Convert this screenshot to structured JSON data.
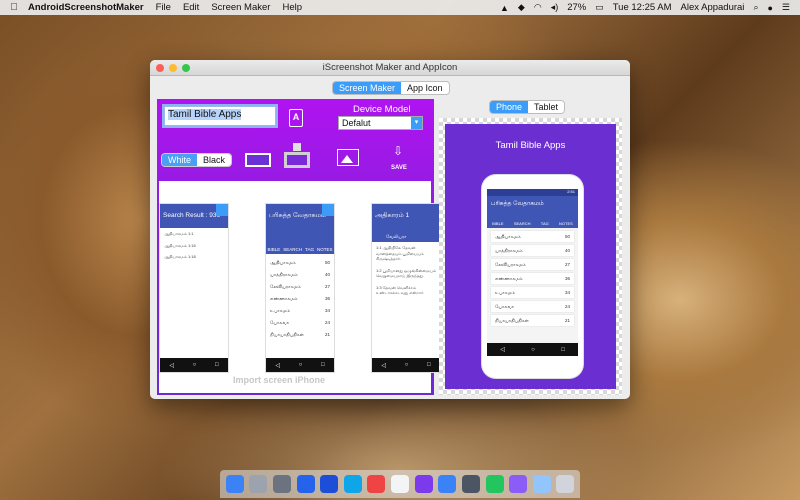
{
  "menubar": {
    "app_name": "AndroidScreenshotMaker",
    "menus": [
      "File",
      "Edit",
      "Screen Maker",
      "Help"
    ],
    "battery": "27%",
    "datetime": "Tue 12:25 AM",
    "user": "Alex Appadurai"
  },
  "window": {
    "title": "iScreenshot Maker and AppIcon",
    "tabs": [
      "Screen Maker",
      "App Icon"
    ],
    "active_tab": "Screen Maker"
  },
  "editor": {
    "title_value": "Tamil Bible Apps",
    "device_model_label": "Device Model",
    "device_model_value": "Defalut",
    "color_options": [
      "White",
      "Black"
    ],
    "active_color": "White",
    "save_label": "SAVE",
    "import_label": "Import screen iPhone"
  },
  "device_tabs": [
    "Phone",
    "Tablet"
  ],
  "active_device": "Phone",
  "screens": [
    {
      "header": "Search Result : 936",
      "texts": [
        "ஆதியாகமம் 1:1",
        "ஆதியாகமம் 1:16",
        "ஆதியாகமம் 1:18"
      ]
    },
    {
      "header": "பரிசுத்த வேதாகமம்",
      "tabs": [
        "BIBLE",
        "SEARCH",
        "TAG",
        "NOTES"
      ],
      "rows": [
        [
          "ஆதியாகமம்",
          "50"
        ],
        [
          "யாத்திராகமம்",
          "40"
        ],
        [
          "லேவியராகமம்",
          "27"
        ],
        [
          "எண்ணாகமம்",
          "36"
        ],
        [
          "உபாகமம்",
          "34"
        ],
        [
          "யோசுவா",
          "24"
        ],
        [
          "நியாயாதிபதிகள்",
          "21"
        ]
      ]
    },
    {
      "header": "அதிகாரம் 1",
      "sub": "வேலியரா",
      "texts": [
        "1:1 ஆதியிலே தேவன் வானத்தையும் பூமியையும் சிருஷ்டித்தார்.",
        "1:2 பூமியானது ஒழுங்கின்மையும் வெறுமையுமாய் இருந்தது.",
        "1:3 தேவன் வெளிச்சம் உண்டாகக்கடவது என்றார்."
      ]
    }
  ],
  "preview": {
    "title": "Tamil Bible Apps",
    "status_time": "2:51",
    "app_title": "பரிசுத்த வேதாகமம்",
    "tabs": [
      "BIBLE",
      "SEARCH",
      "TAG",
      "NOTES"
    ],
    "rows": [
      [
        "ஆதியாகமம்",
        "50"
      ],
      [
        "யாத்திராகமம்",
        "40"
      ],
      [
        "லேவியராகமம்",
        "27"
      ],
      [
        "எண்ணாகமம்",
        "36"
      ],
      [
        "உபாகமம்",
        "34"
      ],
      [
        "யோசுவா",
        "24"
      ],
      [
        "நியாயாதிபதிகள்",
        "21"
      ]
    ]
  },
  "colors": {
    "accent_blue": "#3b9df8",
    "panel_purple": "#7a24d6",
    "android_blue": "#3f56b4"
  }
}
